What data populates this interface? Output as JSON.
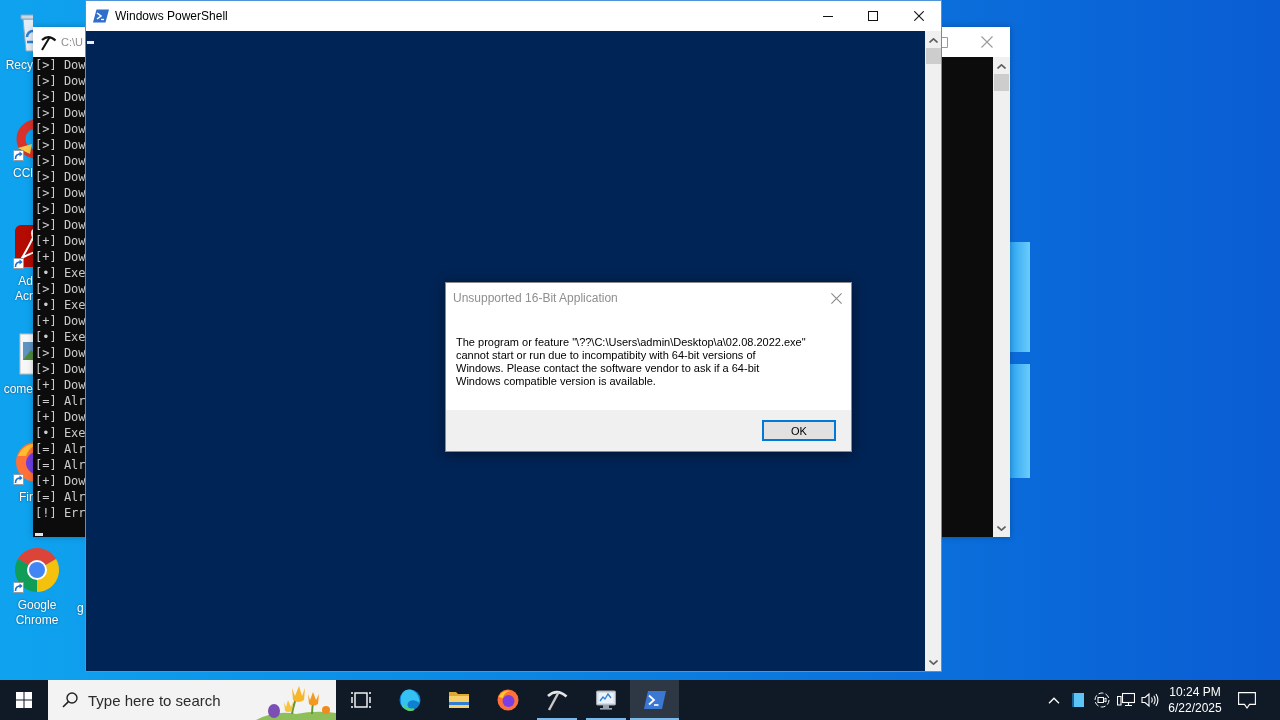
{
  "desktop": {
    "icons": [
      {
        "kind": "recycle-bin",
        "lines": [
          "Recy"
        ],
        "shortcut": false
      },
      {
        "kind": "ccleaner",
        "lines": [
          "CCl"
        ],
        "shortcut": true
      },
      {
        "kind": "acrobat",
        "lines": [
          "Ad",
          "Acr"
        ],
        "shortcut": true
      },
      {
        "kind": "image",
        "lines": [
          "come"
        ],
        "shortcut": false
      },
      {
        "kind": "firefox",
        "lines": [
          "Fir"
        ],
        "shortcut": true
      },
      {
        "kind": "chrome",
        "lines": [
          "Google",
          "Chrome"
        ],
        "shortcut": true
      }
    ],
    "partly_hidden_label": "g"
  },
  "console_window": {
    "title": "C:\\U",
    "lines": [
      "[>] Dow",
      "[>] Dow",
      "[>] Dow",
      "[>] Dow",
      "[>] Dow",
      "[>] Dow",
      "[>] Dow",
      "[>] Dow",
      "[>] Dow",
      "[>] Dow",
      "[>] Dow",
      "[+] Dow",
      "[+] Dow",
      "[•] Exe",
      "[>] Dow",
      "[•] Exe",
      "[+] Dow",
      "[•] Exe",
      "[>] Dow",
      "[>] Dow",
      "[+] Dow",
      "[=] Alr",
      "[+] Dow",
      "[•] Exe",
      "[=] Alr",
      "[=] Alr",
      "[+] Dow",
      "[=] Alr",
      "[!] Err"
    ]
  },
  "powershell_window": {
    "title": "Windows PowerShell"
  },
  "dialog": {
    "title": "Unsupported 16-Bit Application",
    "message": "The program or feature \"\\??\\C:\\Users\\admin\\Desktop\\a\\02.08.2022.exe\"\ncannot start or run due to incompatibity with 64-bit versions of\nWindows. Please contact the software vendor to ask if a 64-bit\nWindows compatible version is available.",
    "buttons": [
      {
        "label": "OK",
        "default": true
      }
    ]
  },
  "taskbar": {
    "search": {
      "placeholder": "Type here to search"
    },
    "apps": [
      {
        "kind": "task-view",
        "running": false,
        "active": false
      },
      {
        "kind": "edge",
        "running": false,
        "active": false
      },
      {
        "kind": "folder",
        "running": false,
        "active": false
      },
      {
        "kind": "firefox",
        "running": false,
        "active": false
      },
      {
        "kind": "pickaxe",
        "running": true,
        "active": false
      },
      {
        "kind": "monitor",
        "running": true,
        "active": false
      },
      {
        "kind": "powershell",
        "running": true,
        "active": true
      }
    ],
    "clock": {
      "time": "10:24 PM",
      "date": "6/22/2025"
    }
  }
}
